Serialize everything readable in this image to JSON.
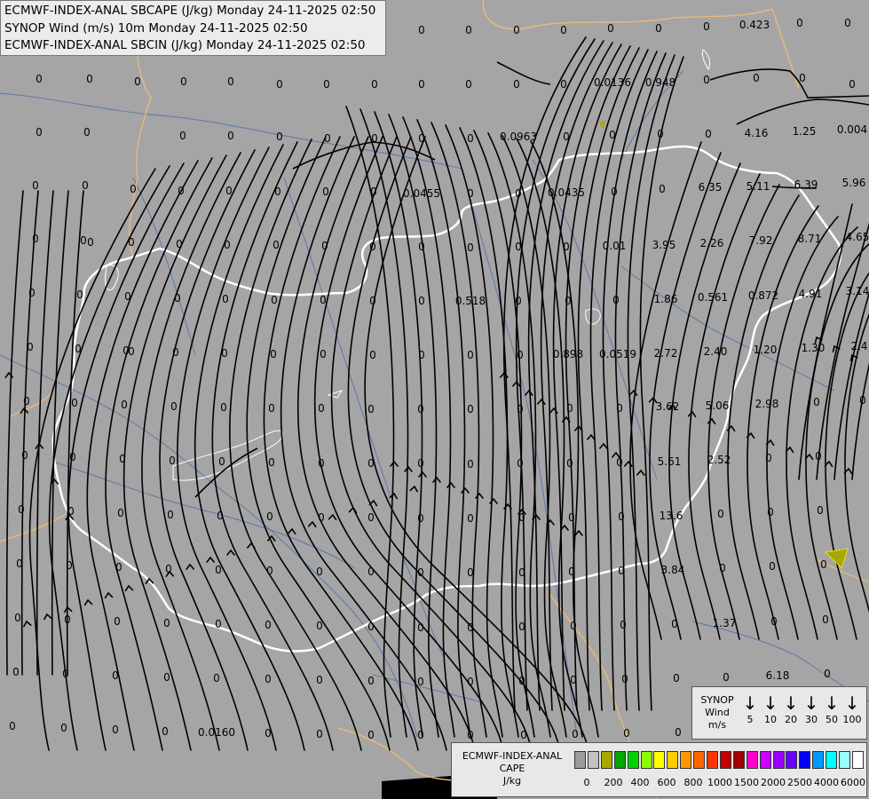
{
  "titles": [
    "ECMWF-INDEX-ANAL SBCAPE (J/kg) Monday 24-11-2025 02:50",
    "SYNOP Wind (m/s) 10m Monday 24-11-2025 02:50",
    "ECMWF-INDEX-ANAL SBCIN (J/kg) Monday 24-11-2025 02:50"
  ],
  "synop_legend": {
    "title_lines": [
      "SYNOP",
      "Wind",
      "m/s"
    ],
    "items": [
      "5",
      "10",
      "20",
      "30",
      "50",
      "100"
    ],
    "arrow_icon": "down-arrow-icon"
  },
  "cape_legend": {
    "title_lines": [
      "ECMWF-INDEX-ANAL",
      "CAPE",
      "J/kg"
    ],
    "colors": [
      "#9c9c9c",
      "#c2c2c2",
      "#a8a800",
      "#00a800",
      "#00d400",
      "#8cff00",
      "#ffff00",
      "#ffcc00",
      "#ff9900",
      "#ff6600",
      "#ff3300",
      "#c40000",
      "#a00000",
      "#ff00cc",
      "#cc00ff",
      "#9900ff",
      "#6600ff",
      "#0000ff",
      "#0099ff",
      "#00ffff",
      "#99ffff",
      "#ffffff"
    ],
    "ticks": [
      "0",
      "200",
      "400",
      "600",
      "800",
      "1000",
      "1500",
      "2000",
      "2500",
      "4000",
      "6000"
    ]
  },
  "map_colors": {
    "background": "#a5a5a5",
    "national_border": "#ffffff",
    "foreign_border": "#e8b87a",
    "rivers": "#5a7aa8",
    "streamlines": "#000000",
    "cape_marker": "#a8a800"
  },
  "grid_values": [
    [
      44,
      93,
      "0"
    ],
    [
      101,
      93,
      "0"
    ],
    [
      155,
      96,
      "0"
    ],
    [
      207,
      96,
      "0"
    ],
    [
      260,
      96,
      "0"
    ],
    [
      315,
      99,
      "0"
    ],
    [
      368,
      99,
      "0"
    ],
    [
      422,
      99,
      "0"
    ],
    [
      475,
      99,
      "0"
    ],
    [
      528,
      99,
      "0"
    ],
    [
      582,
      99,
      "0"
    ],
    [
      635,
      99,
      "0"
    ],
    [
      690,
      97,
      "0.0136"
    ],
    [
      744,
      97,
      "0.948"
    ],
    [
      796,
      94,
      "0"
    ],
    [
      852,
      92,
      "0"
    ],
    [
      904,
      92,
      "0"
    ],
    [
      960,
      99,
      "0"
    ],
    [
      475,
      38,
      "0"
    ],
    [
      528,
      38,
      "0"
    ],
    [
      582,
      38,
      "0"
    ],
    [
      635,
      38,
      "0"
    ],
    [
      688,
      36,
      "0"
    ],
    [
      742,
      36,
      "0"
    ],
    [
      796,
      34,
      "0"
    ],
    [
      850,
      32,
      "0.423"
    ],
    [
      901,
      30,
      "0"
    ],
    [
      955,
      30,
      "0"
    ],
    [
      44,
      153,
      "0"
    ],
    [
      98,
      153,
      "0"
    ],
    [
      206,
      157,
      "0"
    ],
    [
      260,
      157,
      "0"
    ],
    [
      315,
      158,
      "0"
    ],
    [
      369,
      160,
      "0"
    ],
    [
      422,
      160,
      "0"
    ],
    [
      475,
      160,
      "0"
    ],
    [
      530,
      160,
      "0"
    ],
    [
      584,
      158,
      "0.0963"
    ],
    [
      638,
      158,
      "0"
    ],
    [
      690,
      156,
      "0"
    ],
    [
      744,
      155,
      "0"
    ],
    [
      798,
      155,
      "0"
    ],
    [
      852,
      154,
      "4.16"
    ],
    [
      906,
      152,
      "1.25"
    ],
    [
      960,
      150,
      "0.004"
    ],
    [
      40,
      213,
      "0"
    ],
    [
      96,
      213,
      "0"
    ],
    [
      150,
      217,
      "0"
    ],
    [
      204,
      219,
      "0"
    ],
    [
      258,
      219,
      "0"
    ],
    [
      313,
      220,
      "0"
    ],
    [
      367,
      220,
      "0"
    ],
    [
      421,
      220,
      "0"
    ],
    [
      475,
      222,
      "0.0455"
    ],
    [
      530,
      222,
      "0"
    ],
    [
      584,
      222,
      "0"
    ],
    [
      638,
      221,
      "0.0435"
    ],
    [
      692,
      220,
      "0"
    ],
    [
      746,
      217,
      "0"
    ],
    [
      800,
      215,
      "6.35"
    ],
    [
      854,
      214,
      "5.11"
    ],
    [
      908,
      212,
      "6.39"
    ],
    [
      962,
      210,
      "5.96"
    ],
    [
      40,
      273,
      "0"
    ],
    [
      94,
      275,
      "0"
    ],
    [
      148,
      277,
      "0"
    ],
    [
      202,
      279,
      "0"
    ],
    [
      256,
      280,
      "0"
    ],
    [
      311,
      280,
      "0"
    ],
    [
      366,
      281,
      "0"
    ],
    [
      420,
      282,
      "0"
    ],
    [
      475,
      282,
      "0"
    ],
    [
      530,
      283,
      "0"
    ],
    [
      584,
      282,
      "0"
    ],
    [
      638,
      282,
      "0"
    ],
    [
      692,
      281,
      "0.01"
    ],
    [
      748,
      280,
      "3.95"
    ],
    [
      802,
      278,
      "2.26"
    ],
    [
      857,
      275,
      "7.92"
    ],
    [
      912,
      273,
      "8.71"
    ],
    [
      966,
      271,
      "4.65"
    ],
    [
      36,
      334,
      "0"
    ],
    [
      90,
      336,
      "0"
    ],
    [
      144,
      338,
      "0"
    ],
    [
      200,
      340,
      "0"
    ],
    [
      254,
      341,
      "0"
    ],
    [
      309,
      342,
      "0"
    ],
    [
      364,
      342,
      "0"
    ],
    [
      420,
      343,
      "0"
    ],
    [
      475,
      343,
      "0"
    ],
    [
      530,
      343,
      "0.518"
    ],
    [
      584,
      343,
      "0"
    ],
    [
      640,
      343,
      "0"
    ],
    [
      694,
      342,
      "0"
    ],
    [
      750,
      341,
      "1.86"
    ],
    [
      803,
      339,
      "0.561"
    ],
    [
      860,
      337,
      "0.872"
    ],
    [
      913,
      335,
      "4.91"
    ],
    [
      966,
      332,
      "3.14"
    ],
    [
      34,
      395,
      "0"
    ],
    [
      88,
      397,
      "0"
    ],
    [
      142,
      399,
      "0"
    ],
    [
      198,
      401,
      "0"
    ],
    [
      253,
      402,
      "0"
    ],
    [
      308,
      403,
      "0"
    ],
    [
      364,
      403,
      "0"
    ],
    [
      420,
      404,
      "0"
    ],
    [
      475,
      404,
      "0"
    ],
    [
      530,
      404,
      "0"
    ],
    [
      586,
      404,
      "0"
    ],
    [
      640,
      403,
      "0.898"
    ],
    [
      696,
      403,
      "0.0519"
    ],
    [
      750,
      402,
      "2.72"
    ],
    [
      806,
      400,
      "2.40"
    ],
    [
      862,
      398,
      "1.20"
    ],
    [
      916,
      396,
      "1.30"
    ],
    [
      968,
      394,
      "2.4"
    ],
    [
      30,
      456,
      "0"
    ],
    [
      84,
      458,
      "0"
    ],
    [
      140,
      460,
      "0"
    ],
    [
      196,
      462,
      "0"
    ],
    [
      252,
      463,
      "0"
    ],
    [
      306,
      464,
      "0"
    ],
    [
      362,
      464,
      "0"
    ],
    [
      418,
      465,
      "0"
    ],
    [
      474,
      465,
      "0"
    ],
    [
      530,
      465,
      "0"
    ],
    [
      586,
      465,
      "0"
    ],
    [
      642,
      464,
      "0"
    ],
    [
      698,
      464,
      "0"
    ],
    [
      752,
      462,
      "3.62"
    ],
    [
      808,
      461,
      "5.06"
    ],
    [
      864,
      459,
      "2.98"
    ],
    [
      920,
      457,
      "0"
    ],
    [
      972,
      455,
      "0"
    ],
    [
      28,
      517,
      "0"
    ],
    [
      82,
      519,
      "0"
    ],
    [
      138,
      521,
      "0"
    ],
    [
      194,
      523,
      "0"
    ],
    [
      250,
      524,
      "0"
    ],
    [
      306,
      525,
      "0"
    ],
    [
      362,
      526,
      "0"
    ],
    [
      418,
      526,
      "0"
    ],
    [
      474,
      526,
      "0"
    ],
    [
      530,
      527,
      "0"
    ],
    [
      586,
      526,
      "0"
    ],
    [
      642,
      526,
      "0"
    ],
    [
      698,
      525,
      "0"
    ],
    [
      754,
      524,
      "5.61"
    ],
    [
      810,
      522,
      "2.52"
    ],
    [
      866,
      520,
      "0"
    ],
    [
      922,
      518,
      "0"
    ],
    [
      24,
      578,
      "0"
    ],
    [
      80,
      580,
      "0"
    ],
    [
      136,
      582,
      "0"
    ],
    [
      192,
      584,
      "0"
    ],
    [
      248,
      585,
      "0"
    ],
    [
      304,
      586,
      "0"
    ],
    [
      362,
      587,
      "0"
    ],
    [
      418,
      587,
      "0"
    ],
    [
      474,
      588,
      "0"
    ],
    [
      530,
      588,
      "0"
    ],
    [
      588,
      587,
      "0"
    ],
    [
      644,
      587,
      "0"
    ],
    [
      700,
      586,
      "0"
    ],
    [
      756,
      585,
      "13.6"
    ],
    [
      812,
      583,
      "0"
    ],
    [
      868,
      581,
      "0"
    ],
    [
      924,
      579,
      "0"
    ],
    [
      22,
      639,
      "0"
    ],
    [
      78,
      641,
      "0"
    ],
    [
      134,
      643,
      "0"
    ],
    [
      190,
      645,
      "0"
    ],
    [
      246,
      646,
      "0"
    ],
    [
      304,
      647,
      "0"
    ],
    [
      360,
      648,
      "0"
    ],
    [
      418,
      648,
      "0"
    ],
    [
      474,
      649,
      "0"
    ],
    [
      530,
      649,
      "0"
    ],
    [
      588,
      649,
      "0"
    ],
    [
      644,
      648,
      "0"
    ],
    [
      700,
      647,
      "0"
    ],
    [
      758,
      646,
      "3.84"
    ],
    [
      814,
      644,
      "0"
    ],
    [
      870,
      642,
      "0"
    ],
    [
      928,
      640,
      "0"
    ],
    [
      20,
      700,
      "0"
    ],
    [
      76,
      702,
      "0"
    ],
    [
      132,
      704,
      "0"
    ],
    [
      188,
      706,
      "0"
    ],
    [
      246,
      707,
      "0"
    ],
    [
      302,
      708,
      "0"
    ],
    [
      360,
      709,
      "0"
    ],
    [
      418,
      710,
      "0"
    ],
    [
      474,
      711,
      "0"
    ],
    [
      530,
      711,
      "0"
    ],
    [
      588,
      710,
      "0"
    ],
    [
      646,
      709,
      "0"
    ],
    [
      702,
      708,
      "0"
    ],
    [
      760,
      707,
      "0"
    ],
    [
      816,
      706,
      "1.37"
    ],
    [
      872,
      704,
      "0"
    ],
    [
      930,
      702,
      "0"
    ],
    [
      18,
      761,
      "0"
    ],
    [
      74,
      763,
      "0"
    ],
    [
      130,
      765,
      "0"
    ],
    [
      188,
      767,
      "0"
    ],
    [
      244,
      768,
      "0"
    ],
    [
      302,
      769,
      "0"
    ],
    [
      360,
      770,
      "0"
    ],
    [
      418,
      771,
      "0"
    ],
    [
      474,
      772,
      "0"
    ],
    [
      530,
      772,
      "0"
    ],
    [
      588,
      771,
      "0"
    ],
    [
      646,
      770,
      "0"
    ],
    [
      704,
      769,
      "0"
    ],
    [
      762,
      768,
      "0"
    ],
    [
      818,
      767,
      "0"
    ],
    [
      876,
      765,
      "6.18"
    ],
    [
      932,
      763,
      "0"
    ],
    [
      14,
      822,
      "0"
    ],
    [
      72,
      824,
      "0"
    ],
    [
      130,
      826,
      "0"
    ],
    [
      186,
      828,
      "0"
    ],
    [
      244,
      829,
      "0.0160"
    ],
    [
      302,
      830,
      "0"
    ],
    [
      360,
      831,
      "0"
    ],
    [
      418,
      832,
      "0"
    ],
    [
      474,
      832,
      "0"
    ],
    [
      530,
      832,
      "0"
    ],
    [
      590,
      832,
      "0"
    ],
    [
      648,
      831,
      "0"
    ],
    [
      706,
      830,
      "0"
    ],
    [
      764,
      829,
      "0"
    ],
    [
      820,
      828,
      "0"
    ],
    [
      876,
      827,
      "0"
    ],
    [
      932,
      826,
      "0"
    ],
    [
      102,
      277,
      "0"
    ],
    [
      148,
      400,
      "0"
    ]
  ]
}
